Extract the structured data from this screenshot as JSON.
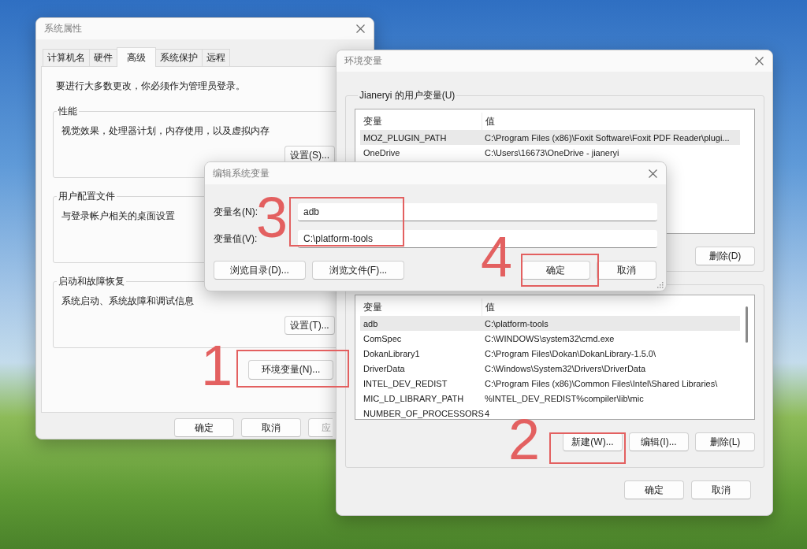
{
  "system_properties": {
    "title": "系统属性",
    "tabs": [
      {
        "label": "计算机名",
        "selected": false
      },
      {
        "label": "硬件",
        "selected": false
      },
      {
        "label": "高级",
        "selected": true
      },
      {
        "label": "系统保护",
        "selected": false
      },
      {
        "label": "远程",
        "selected": false
      }
    ],
    "notice": "要进行大多数更改，你必须作为管理员登录。",
    "groups": [
      {
        "title": "性能",
        "description": "视觉效果，处理器计划，内存使用，以及虚拟内存",
        "button": "设置(S)..."
      },
      {
        "title": "用户配置文件",
        "description": "与登录帐户相关的桌面设置"
      },
      {
        "title": "启动和故障恢复",
        "description": "系统启动、系统故障和调试信息",
        "button": "设置(T)..."
      }
    ],
    "env_button": "环境变量(N)...",
    "buttons": [
      {
        "label": "确定",
        "disabled": false
      },
      {
        "label": "取消",
        "disabled": false
      },
      {
        "label": "应",
        "disabled": true
      }
    ]
  },
  "env_vars": {
    "title": "环境变量",
    "user_group": "Jianeryi 的用户变量(U)",
    "user_table": {
      "columns": [
        "变量",
        "值"
      ],
      "rows": [
        {
          "cells": [
            "MOZ_PLUGIN_PATH",
            "C:\\Program Files (x86)\\Foxit Software\\Foxit PDF Reader\\plugi..."
          ],
          "selected": true
        },
        {
          "cells": [
            "OneDrive",
            "C:\\Users\\16673\\OneDrive - jianeryi"
          ],
          "selected": false
        }
      ]
    },
    "user_buttons": [
      "删除(D)"
    ],
    "system_table": {
      "columns": [
        "变量",
        "值"
      ],
      "rows": [
        {
          "cells": [
            "adb",
            "C:\\platform-tools"
          ],
          "selected": true
        },
        {
          "cells": [
            "ComSpec",
            "C:\\WINDOWS\\system32\\cmd.exe"
          ],
          "selected": false
        },
        {
          "cells": [
            "DokanLibrary1",
            "C:\\Program Files\\Dokan\\DokanLibrary-1.5.0\\"
          ],
          "selected": false
        },
        {
          "cells": [
            "DriverData",
            "C:\\Windows\\System32\\Drivers\\DriverData"
          ],
          "selected": false
        },
        {
          "cells": [
            "INTEL_DEV_REDIST",
            "C:\\Program Files (x86)\\Common Files\\Intel\\Shared Libraries\\"
          ],
          "selected": false
        },
        {
          "cells": [
            "MIC_LD_LIBRARY_PATH",
            "%INTEL_DEV_REDIST%compiler\\lib\\mic"
          ],
          "selected": false
        },
        {
          "cells": [
            "NUMBER_OF_PROCESSORS",
            "4"
          ],
          "selected": false
        }
      ]
    },
    "system_buttons": [
      "新建(W)...",
      "编辑(I)...",
      "删除(L)"
    ],
    "buttons": [
      "确定",
      "取消"
    ]
  },
  "edit_dialog": {
    "title": "编辑系统变量",
    "fields": [
      {
        "label": "变量名(N):",
        "value": "adb"
      },
      {
        "label": "变量值(V):",
        "value": "C:\\platform-tools"
      }
    ],
    "browse_buttons": [
      "浏览目录(D)...",
      "浏览文件(F)..."
    ],
    "buttons": [
      "确定",
      "取消"
    ]
  },
  "annotations": [
    {
      "number": "1"
    },
    {
      "number": "2"
    },
    {
      "number": "3"
    },
    {
      "number": "4"
    }
  ]
}
